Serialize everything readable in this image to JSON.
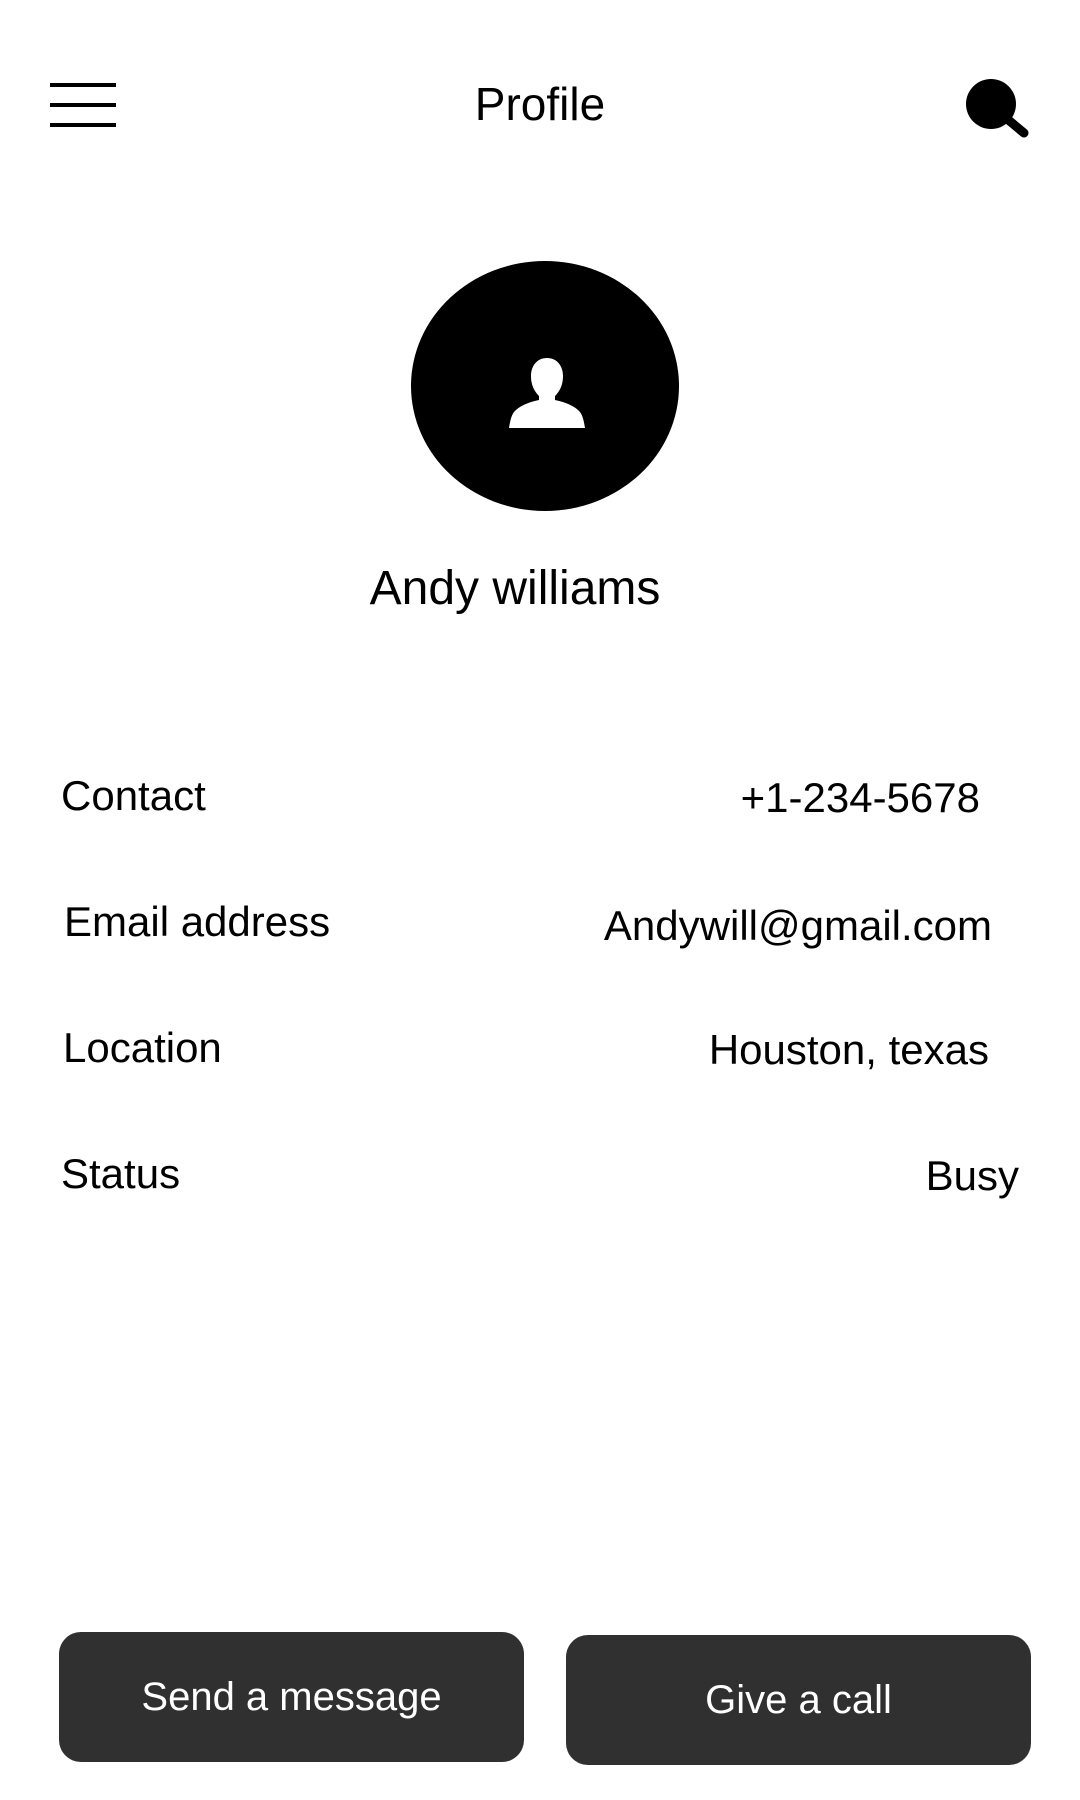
{
  "header": {
    "title": "Profile",
    "menu_icon": "hamburger-menu-icon",
    "search_icon": "search-icon"
  },
  "profile": {
    "avatar_icon": "person-icon",
    "name": "Andy williams"
  },
  "info": {
    "contact": {
      "label": "Contact",
      "value": "+1-234-5678"
    },
    "email": {
      "label": "Email address",
      "value": "Andywill@gmail.com"
    },
    "location": {
      "label": "Location",
      "value": "Houston, texas"
    },
    "status": {
      "label": "Status",
      "value": "Busy"
    }
  },
  "actions": {
    "message_label": "Send a message",
    "call_label": "Give a call"
  },
  "colors": {
    "button_bg": "#303030",
    "button_text": "#ffffff",
    "avatar_bg": "#000000"
  }
}
